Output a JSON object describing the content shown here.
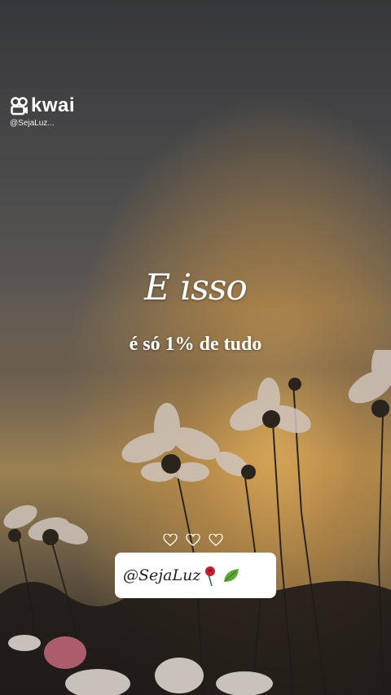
{
  "watermark": {
    "brand": "kwai",
    "handle": "@SejaLuz..."
  },
  "quote": {
    "title": "E isso",
    "subtitle": "é só 1% de tudo"
  },
  "tag": {
    "text": "@SejaLuz"
  },
  "icons": [
    "kwai-logo-icon",
    "heart-icon",
    "rose-icon",
    "leaf-icon"
  ],
  "colors": {
    "text": "#ffffff",
    "tag_background": "#ffffff",
    "sunset_glow": "#deaa58"
  }
}
